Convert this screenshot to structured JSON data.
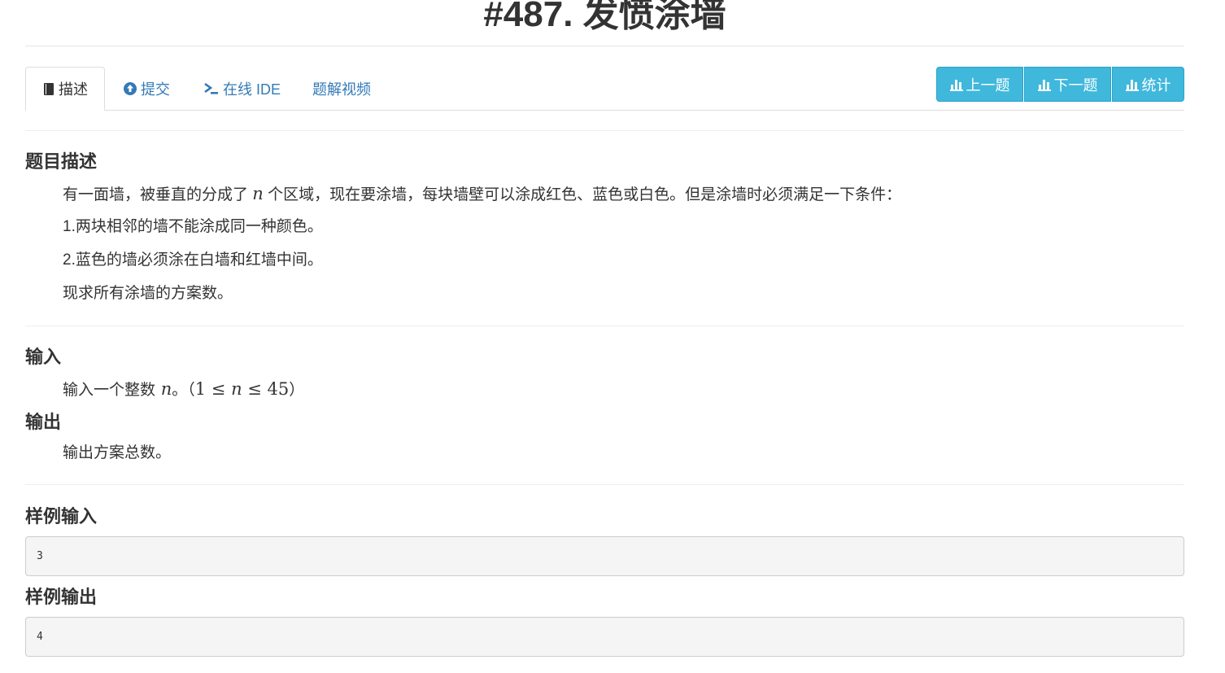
{
  "title": "#487. 发愤涂墙",
  "tabs": [
    {
      "label": "描述",
      "icon": "book-icon"
    },
    {
      "label": "提交",
      "icon": "upload-circle-icon"
    },
    {
      "label": "在线 IDE",
      "icon": "terminal-icon"
    },
    {
      "label": "题解视频",
      "icon": ""
    }
  ],
  "nav_buttons": [
    {
      "label": "上一题",
      "icon": "bar-chart-icon"
    },
    {
      "label": "下一题",
      "icon": "bar-chart-icon"
    },
    {
      "label": "统计",
      "icon": "bar-chart-icon"
    }
  ],
  "description": {
    "heading": "题目描述",
    "line1_pre": "有一面墙，被垂直的分成了",
    "line1_var": "n",
    "line1_post": "个区域，现在要涂墙，每块墙壁可以涂成红色、蓝色或白色。但是涂墙时必须满足一下条件：",
    "rule1": "1.两块相邻的墙不能涂成同一种颜色。",
    "rule2": "2.蓝色的墙必须涂在白墙和红墙中间。",
    "line4": "现求所有涂墙的方案数。"
  },
  "input": {
    "heading": "输入",
    "text_pre": "输入一个整数",
    "var": "n",
    "text_mid": "。（",
    "constraint_lo": "1 ≤ ",
    "constraint_var": "n",
    "constraint_hi": " ≤ 45",
    "text_post": "）"
  },
  "output": {
    "heading": "输出",
    "text": "输出方案总数。"
  },
  "sample_input": {
    "heading": "样例输入",
    "value": "3"
  },
  "sample_output": {
    "heading": "样例输出",
    "value": "4"
  },
  "colors": {
    "accent": "#3fb8dc",
    "link": "#337ab7",
    "text": "#333333"
  }
}
